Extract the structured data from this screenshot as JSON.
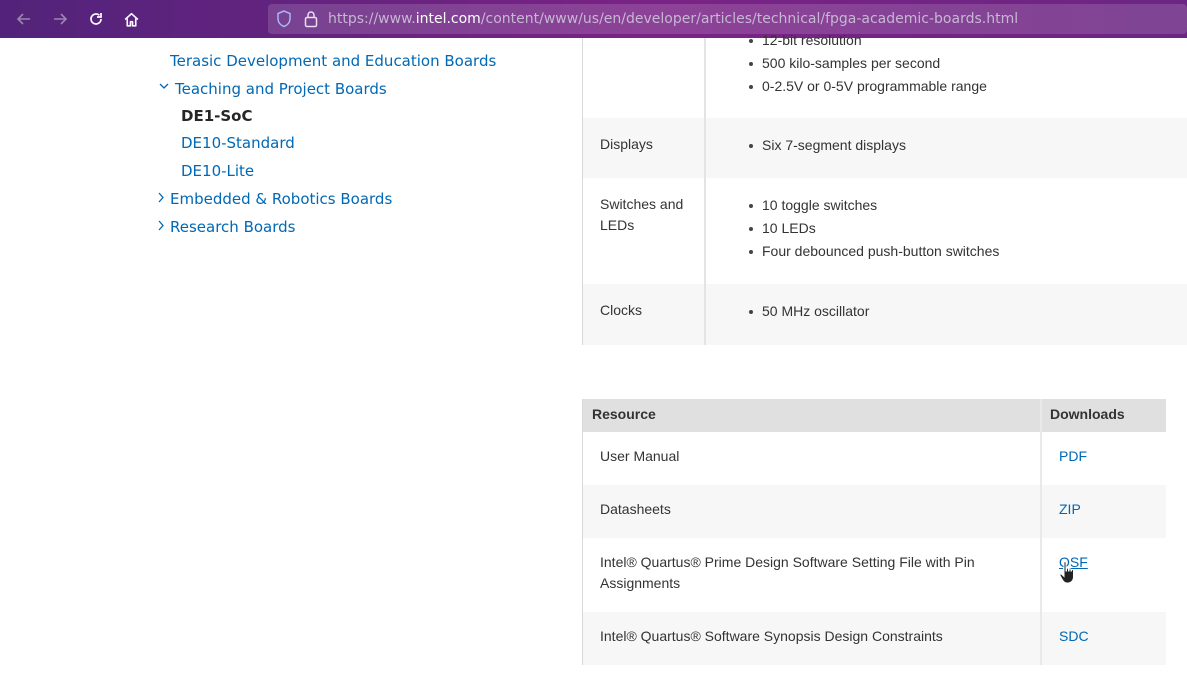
{
  "browser": {
    "url_prefix": "https://www.",
    "url_domain": "intel.com",
    "url_path": "/content/www/us/en/developer/articles/technical/fpga-academic-boards.html"
  },
  "nav": {
    "terasic": "Terasic Development and Education Boards",
    "teaching": "Teaching and Project Boards",
    "current": "DE1-SoC",
    "de10_standard": "DE10-Standard",
    "de10_lite": "DE10-Lite",
    "embedded": "Embedded & Robotics Boards",
    "research": "Research Boards"
  },
  "spec": {
    "adc_bullets": [
      "12-bit resolution",
      "500 kilo-samples per second",
      "0-2.5V or 0-5V programmable range"
    ],
    "displays": {
      "label": "Displays",
      "bullets": [
        "Six 7-segment displays"
      ]
    },
    "switches": {
      "label_line1": "Switches and",
      "label_line2": "LEDs",
      "bullets": [
        "10 toggle switches",
        "10 LEDs",
        "Four debounced push-button switches"
      ]
    },
    "clocks": {
      "label": "Clocks",
      "bullets": [
        "50 MHz oscillator"
      ]
    }
  },
  "resources": {
    "header_resource": "Resource",
    "header_downloads": "Downloads",
    "rows": [
      {
        "name": "User Manual",
        "link": "PDF"
      },
      {
        "name": "Datasheets",
        "link": "ZIP"
      },
      {
        "name_line1": "Intel® Quartus® Prime Design Software Setting File with Pin",
        "name_line2": "Assignments",
        "link": "QSF"
      },
      {
        "name": "Intel® Quartus® Software Synopsis Design Constraints",
        "link": "SDC"
      }
    ]
  },
  "colors": {
    "link": "#0068b5",
    "toolbar": "#6b2683"
  }
}
